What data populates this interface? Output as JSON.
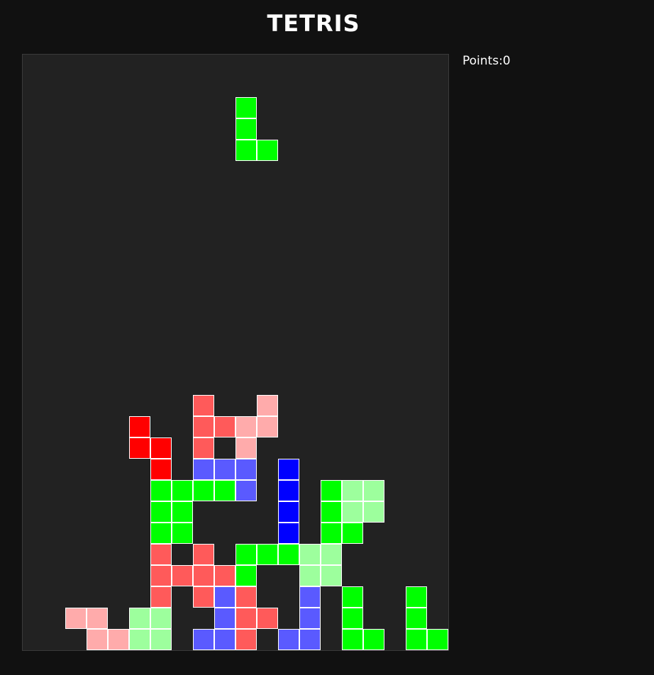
{
  "title": "TETRIS",
  "score": {
    "text": "Points:0"
  },
  "colors": {
    "green": "#00ff00",
    "light_green": "#9dff9d",
    "red": "#ff0000",
    "salmon": "#ff5a5a",
    "pink": "#ffabab",
    "blue": "#0000ff",
    "violet_blue": "#5a5aff"
  },
  "board": {
    "columns": 20,
    "rows": 28,
    "active_piece": {
      "color": "green",
      "cells": [
        [
          10,
          2
        ],
        [
          10,
          3
        ],
        [
          10,
          4
        ],
        [
          11,
          4
        ]
      ]
    },
    "locked": [
      {
        "color": "salmon",
        "cells": [
          [
            8,
            16
          ],
          [
            8,
            17
          ],
          [
            9,
            17
          ],
          [
            8,
            18
          ]
        ]
      },
      {
        "color": "pink",
        "cells": [
          [
            11,
            16
          ],
          [
            10,
            17
          ],
          [
            11,
            17
          ],
          [
            10,
            18
          ]
        ]
      },
      {
        "color": "red",
        "cells": [
          [
            5,
            17
          ],
          [
            5,
            18
          ],
          [
            6,
            18
          ],
          [
            6,
            19
          ]
        ]
      },
      {
        "color": "violet_blue",
        "cells": [
          [
            8,
            19
          ],
          [
            9,
            19
          ],
          [
            10,
            19
          ],
          [
            10,
            20
          ]
        ]
      },
      {
        "color": "blue",
        "cells": [
          [
            12,
            19
          ],
          [
            12,
            20
          ],
          [
            12,
            21
          ],
          [
            12,
            22
          ]
        ]
      },
      {
        "color": "green",
        "cells": [
          [
            6,
            20
          ],
          [
            7,
            20
          ],
          [
            8,
            20
          ],
          [
            9,
            20
          ]
        ]
      },
      {
        "color": "green",
        "cells": [
          [
            6,
            21
          ],
          [
            7,
            21
          ],
          [
            6,
            22
          ],
          [
            7,
            22
          ]
        ]
      },
      {
        "color": "green",
        "cells": [
          [
            14,
            20
          ],
          [
            14,
            21
          ],
          [
            14,
            22
          ],
          [
            15,
            22
          ]
        ]
      },
      {
        "color": "light_green",
        "cells": [
          [
            15,
            20
          ],
          [
            16,
            20
          ],
          [
            15,
            21
          ],
          [
            16,
            21
          ]
        ]
      },
      {
        "color": "salmon",
        "cells": [
          [
            6,
            23
          ],
          [
            6,
            24
          ],
          [
            7,
            24
          ],
          [
            6,
            25
          ]
        ]
      },
      {
        "color": "salmon",
        "cells": [
          [
            8,
            23
          ],
          [
            8,
            24
          ],
          [
            9,
            24
          ],
          [
            8,
            25
          ]
        ]
      },
      {
        "color": "green",
        "cells": [
          [
            10,
            23
          ],
          [
            11,
            23
          ],
          [
            12,
            23
          ],
          [
            10,
            24
          ]
        ]
      },
      {
        "color": "light_green",
        "cells": [
          [
            13,
            23
          ],
          [
            14,
            23
          ],
          [
            13,
            24
          ],
          [
            14,
            24
          ]
        ]
      },
      {
        "color": "violet_blue",
        "cells": [
          [
            9,
            25
          ],
          [
            9,
            26
          ],
          [
            9,
            27
          ],
          [
            8,
            27
          ]
        ]
      },
      {
        "color": "salmon",
        "cells": [
          [
            10,
            25
          ],
          [
            10,
            26
          ],
          [
            11,
            26
          ],
          [
            10,
            27
          ]
        ]
      },
      {
        "color": "violet_blue",
        "cells": [
          [
            13,
            25
          ],
          [
            13,
            26
          ],
          [
            13,
            27
          ],
          [
            12,
            27
          ]
        ]
      },
      {
        "color": "green",
        "cells": [
          [
            15,
            25
          ],
          [
            15,
            26
          ],
          [
            15,
            27
          ],
          [
            16,
            27
          ]
        ]
      },
      {
        "color": "green",
        "cells": [
          [
            18,
            25
          ],
          [
            18,
            26
          ],
          [
            18,
            27
          ],
          [
            19,
            27
          ]
        ]
      },
      {
        "color": "pink",
        "cells": [
          [
            2,
            26
          ],
          [
            3,
            26
          ],
          [
            3,
            27
          ],
          [
            4,
            27
          ]
        ]
      },
      {
        "color": "light_green",
        "cells": [
          [
            5,
            26
          ],
          [
            6,
            26
          ],
          [
            5,
            27
          ],
          [
            6,
            27
          ]
        ]
      }
    ]
  }
}
